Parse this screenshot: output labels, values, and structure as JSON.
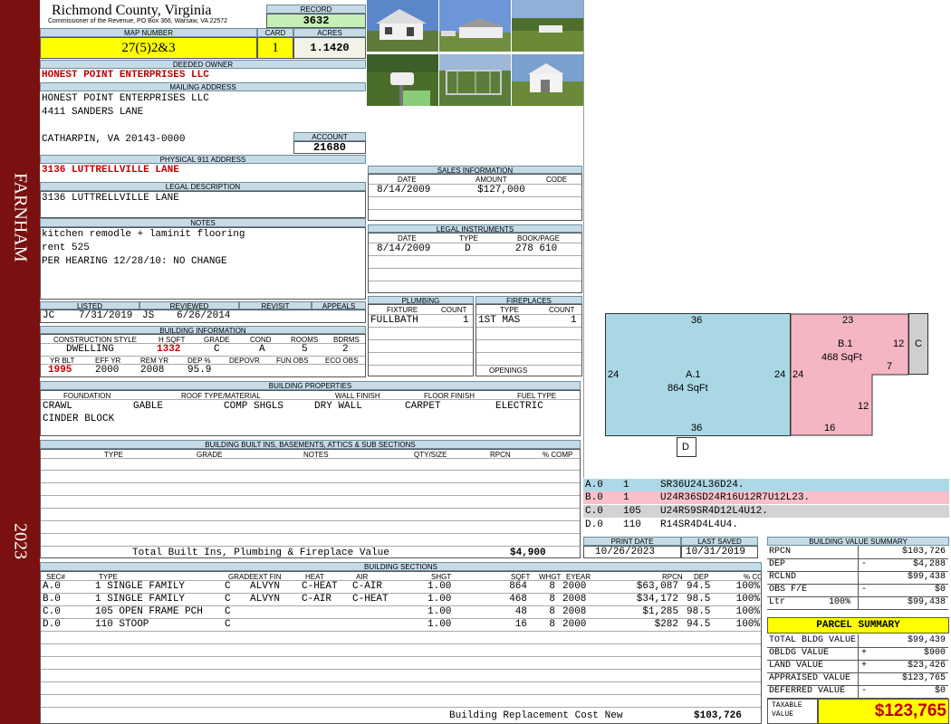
{
  "sidebar": {
    "top": "FARNHAM",
    "bottom": "2023"
  },
  "header": {
    "county": "Richmond County, Virginia",
    "commissioner": "Commissioner of the Revenue, PO Box 366, Warsaw, VA 22572",
    "record_label": "RECORD",
    "record": "3632",
    "map_number_label": "MAP NUMBER",
    "map_number": "27(5)2&3",
    "card_label": "CARD",
    "card": "1",
    "acres_label": "ACRES",
    "acres": "1.1420"
  },
  "owner": {
    "deeded_label": "DEEDED OWNER",
    "deeded": "HONEST POINT ENTERPRISES LLC",
    "mailing_label": "MAILING ADDRESS",
    "mail1": "HONEST POINT ENTERPRISES LLC",
    "mail2": "4411 SANDERS LANE",
    "mail3": "CATHARPIN, VA 20143-0000",
    "account_label": "ACCOUNT",
    "account": "21680"
  },
  "physical": {
    "label": "PHYSICAL 911 ADDRESS",
    "address": "3136 LUTTRELLVILLE LANE"
  },
  "legal": {
    "label": "LEGAL DESCRIPTION",
    "text": "3136 LUTTRELLVILLE LANE"
  },
  "notes": {
    "label": "NOTES",
    "lines": [
      "kitchen remodle + laminit flooring",
      "rent 525",
      "PER HEARING 12/28/10: NO CHANGE"
    ]
  },
  "sales": {
    "label": "SALES INFORMATION",
    "h_date": "DATE",
    "h_amount": "AMOUNT",
    "h_code": "CODE",
    "date": "8/14/2009",
    "amount": "$127,000",
    "code": ""
  },
  "instruments": {
    "label": "LEGAL INSTRUMENTS",
    "h_date": "DATE",
    "h_type": "TYPE",
    "h_book": "BOOK/PAGE",
    "date": "8/14/2009",
    "type": "D",
    "book": "278 610"
  },
  "plumbing": {
    "label": "PLUMBING",
    "h_fixture": "FIXTURE",
    "h_count": "COUNT",
    "fixture": "FULLBATH",
    "count": "1"
  },
  "fireplaces": {
    "label": "FIREPLACES",
    "h_type": "TYPE",
    "h_count": "COUNT",
    "type": "1ST MAS",
    "count": "1",
    "openings_label": "OPENINGS"
  },
  "review": {
    "h_listed": "LISTED",
    "h_reviewed": "REVIEWED",
    "h_revisit": "REVISIT",
    "h_appeals": "APPEALS",
    "listed_by": "JC",
    "listed": "7/31/2019",
    "reviewed_by": "JS",
    "reviewed": "6/26/2014"
  },
  "building": {
    "label": "BUILDING INFORMATION",
    "h_style": "CONSTRUCTION STYLE",
    "h_hsqft": "H SQFT",
    "h_grade": "GRADE",
    "h_cond": "COND",
    "h_rooms": "ROOMS",
    "h_bdrms": "BDRMS",
    "style": "DWELLING",
    "hsqft": "1332",
    "grade": "C",
    "cond": "A",
    "rooms": "5",
    "bdrms": "2",
    "h_yrblt": "YR BLT",
    "h_effyr": "EFF YR",
    "h_remyr": "REM YR",
    "h_dep": "DEP %",
    "h_depovr": "DEPOVR",
    "h_funobs": "FUN OBS",
    "h_ecoobs": "ECO OBS",
    "yrblt": "1995",
    "effyr": "2000",
    "remyr": "2008",
    "dep": "95.9"
  },
  "props": {
    "label": "BUILDING PROPERTIES",
    "h_foundation": "FOUNDATION",
    "h_roof": "ROOF TYPE/MATERIAL",
    "h_wall": "WALL FINISH",
    "h_floor": "FLOOR FINISH",
    "h_fuel": "FUEL TYPE",
    "foundation1": "CRAWL",
    "foundation2": "CINDER BLOCK",
    "roof_type": "GABLE",
    "roof_mat": "COMP SHGLS",
    "wall": "DRY WALL",
    "floor": "CARPET",
    "fuel": "ELECTRIC"
  },
  "builtins": {
    "label": "BUILDING BUILT INS, BASEMENTS, ATTICS & SUB SECTIONS",
    "h_type": "TYPE",
    "h_grade": "GRADE",
    "h_notes": "NOTES",
    "h_qty": "QTY/SIZE",
    "h_rpcn": "RPCN",
    "h_comp": "% COMP",
    "total_label": "Total Built Ins, Plumbing & Fireplace Value",
    "total": "$4,900"
  },
  "dates": {
    "h_print": "PRINT DATE",
    "h_saved": "LAST SAVED",
    "print": "10/26/2023",
    "saved": "10/31/2019"
  },
  "sketch": {
    "a_top": "36",
    "a_left": "24",
    "a_right": "24",
    "a_bottom": "36",
    "a_label": "A.1",
    "a_area": "864 SqFt",
    "b_top": "23",
    "b_left": "24",
    "b_right": "12",
    "b_right2": "12",
    "b_notch": "7",
    "b_bottom": "16",
    "b_label": "B.1",
    "b_area": "468 SqFt",
    "c_label": "C",
    "d_label": "D"
  },
  "legend": [
    {
      "code": "A.0",
      "num": "1",
      "vec": "SR36U24L36D24."
    },
    {
      "code": "B.0",
      "num": "1",
      "vec": "U24R36SD24R16U12R7U12L23."
    },
    {
      "code": "C.0",
      "num": "105",
      "vec": "U24R59SR4D12L4U12."
    },
    {
      "code": "D.0",
      "num": "110",
      "vec": "R14SR4D4L4U4."
    }
  ],
  "sections": {
    "label": "BUILDING SECTIONS",
    "headers": [
      "SEC#",
      "TYPE",
      "GRADE",
      "EXT FIN",
      "HEAT",
      "AIR",
      "SHGT",
      "SQFT",
      "WHGT",
      "EYEAR",
      "RPCN",
      "DEP",
      "% COMP"
    ],
    "rows": [
      [
        "A.0",
        "1 SINGLE FAMILY",
        "C",
        "ALVYN",
        "C-HEAT",
        "C-AIR",
        "1.00",
        "864",
        "8",
        "2000",
        "$63,087",
        "94.5",
        "100%"
      ],
      [
        "B.0",
        "1 SINGLE FAMILY",
        "C",
        "ALVYN",
        "C-AIR",
        "C-HEAT",
        "1.00",
        "468",
        "8",
        "2008",
        "$34,172",
        "98.5",
        "100%"
      ],
      [
        "C.0",
        "105 OPEN FRAME PCH",
        "C",
        "",
        "",
        "",
        "1.00",
        "48",
        "8",
        "2008",
        "$1,285",
        "98.5",
        "100%"
      ],
      [
        "D.0",
        "110 STOOP",
        "C",
        "",
        "",
        "",
        "1.00",
        "16",
        "8",
        "2000",
        "$282",
        "94.5",
        "100%"
      ]
    ],
    "rcn_label": "Building Replacement Cost New",
    "rcn": "$103,726"
  },
  "value_summary": {
    "label": "BUILDING VALUE SUMMARY",
    "rows": [
      {
        "l": "RPCN",
        "s": "",
        "v": "$103,726"
      },
      {
        "l": "DEP",
        "s": "-",
        "v": "$4,288"
      },
      {
        "l": "RCLND",
        "s": "",
        "v": "$99,438"
      },
      {
        "l": "OBS F/E",
        "s": "-",
        "v": "$0"
      },
      {
        "l": "Ltr",
        "p": "100%",
        "s": "",
        "v": "$99,438"
      }
    ]
  },
  "parcel": {
    "label": "PARCEL SUMMARY",
    "rows": [
      {
        "l": "TOTAL BLDG VALUE",
        "s": "",
        "v": "$99,439"
      },
      {
        "l": "OBLDG VALUE",
        "s": "+",
        "v": "$900"
      },
      {
        "l": "LAND VALUE",
        "s": "+",
        "v": "$23,426"
      },
      {
        "l": "APPRAISED VALUE",
        "s": "",
        "v": "$123,765"
      },
      {
        "l": "DEFERRED VALUE",
        "s": "-",
        "v": "$0"
      }
    ],
    "taxable_label1": "TAXABLE",
    "taxable_label2": "VALUE",
    "taxable": "$123,765"
  },
  "colors": {
    "sidebar": "#7a1010",
    "header": "#c7dbe6",
    "highlight": "#ffff00",
    "record_bg": "#c6efb5",
    "a_fill": "#a9d7e4",
    "b_fill": "#f4b6c2",
    "c_fill": "#cfcfcf",
    "legend_a": "#add8e6",
    "legend_b": "#f8c0cb",
    "legend_c": "#d3d3d3"
  }
}
